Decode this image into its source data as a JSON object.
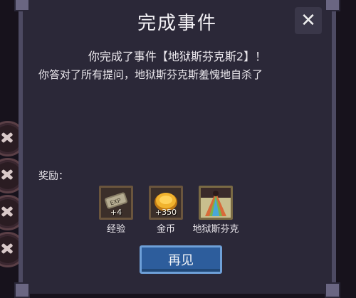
{
  "dialog": {
    "title": "完成事件",
    "close_icon": "✕",
    "headline": "你完成了事件【地狱斯芬克斯2】！",
    "description": "你答对了所有提问，地狱斯芬克斯羞愧地自杀了",
    "rewards_label": "奖励：",
    "rewards": [
      {
        "icon": "exp-scroll-icon",
        "amount": "+4",
        "name": "经验"
      },
      {
        "icon": "gold-coin-icon",
        "amount": "+350",
        "name": "金币"
      },
      {
        "icon": "hell-sphinx-icon",
        "amount": "",
        "name": "地狱斯芬克"
      }
    ],
    "button_label": "再见"
  }
}
